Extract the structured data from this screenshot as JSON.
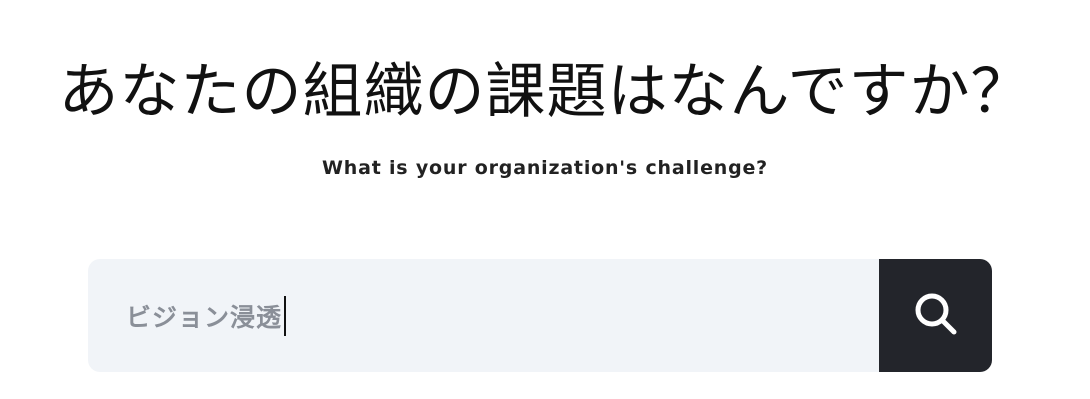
{
  "hero": {
    "title": "あなたの組織の課題はなんですか？",
    "subtitle": "What is your organization's challenge?"
  },
  "search": {
    "value": "ビジョン浸透",
    "button_icon": "search-icon"
  },
  "colors": {
    "field_background": "#f1f4f8",
    "button_background": "#23252b",
    "icon": "#ffffff",
    "value_text": "#8a8f98"
  }
}
